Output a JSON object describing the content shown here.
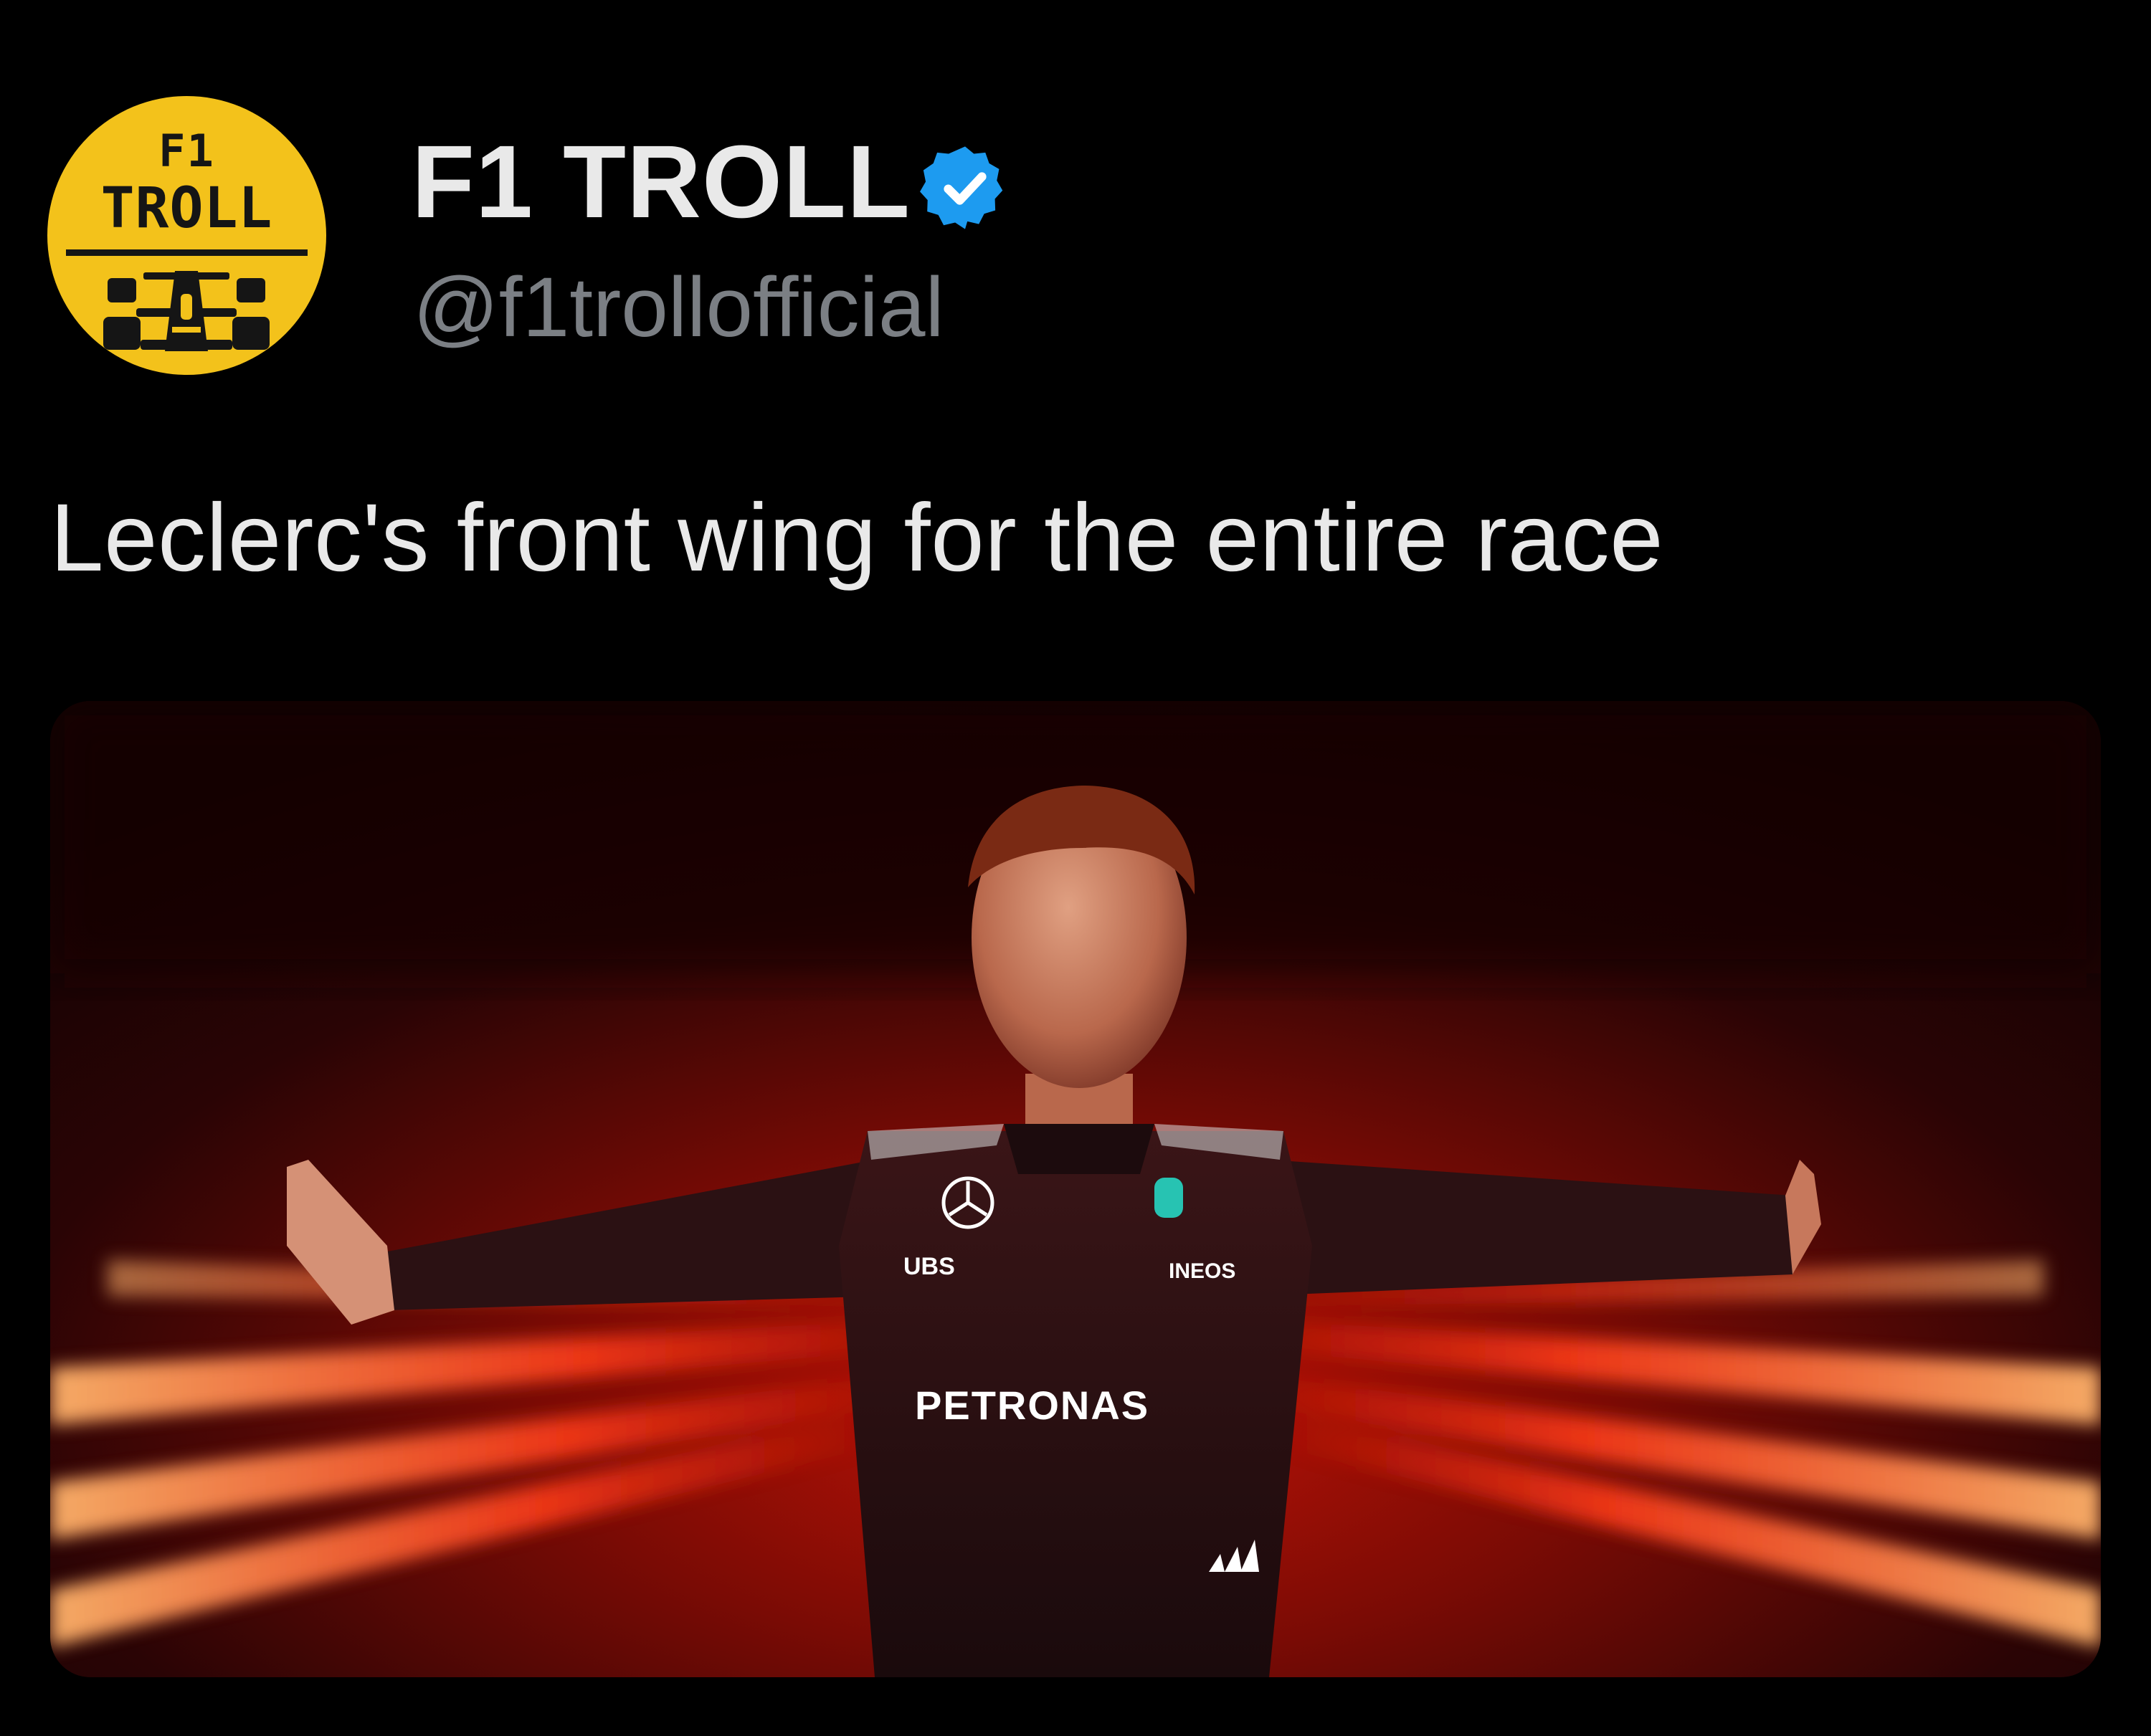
{
  "account": {
    "display_name": "F1 TROLL",
    "handle": "@f1trollofficial",
    "verified": true,
    "avatar": {
      "logo_line1": "F1",
      "logo_line2": "TROLL",
      "background_color": "#f3c21b",
      "icon": "race-car-icon"
    }
  },
  "tweet": {
    "text": "Leclerc's front wing for the entire race"
  },
  "media": {
    "type": "photo",
    "suit_sponsors": {
      "ubs": "UBS",
      "ineos": "INEOS",
      "petronas": "PETRONAS"
    }
  },
  "colors": {
    "background": "#000000",
    "primary_text": "#e9e9e9",
    "secondary_text": "#7b7f84",
    "verified_badge": "#1d9bf0",
    "media_accent": "#e8200e"
  }
}
